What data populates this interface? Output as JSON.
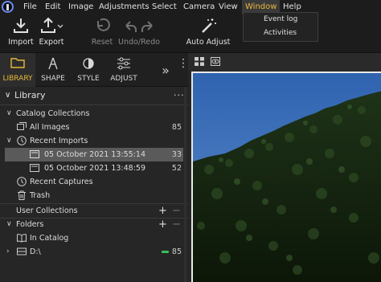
{
  "menubar": {
    "items": [
      "File",
      "Edit",
      "Image",
      "Adjustments",
      "Select",
      "Camera",
      "View",
      "Window",
      "Help"
    ],
    "active": "Window"
  },
  "window_menu": {
    "items": [
      "Event log",
      "Activities"
    ]
  },
  "toolbar": {
    "import_label": "Import",
    "export_label": "Export",
    "reset_label": "Reset",
    "undo_redo_label": "Undo/Redo",
    "auto_adjust_label": "Auto Adjust"
  },
  "tabs": {
    "library": "LIBRARY",
    "shape": "SHAPE",
    "style": "STYLE",
    "adjust": "ADJUST",
    "more": "»",
    "menu": "⋮"
  },
  "library": {
    "title": "Library",
    "menu": "···",
    "catalog_collections": "Catalog Collections",
    "all_images": {
      "label": "All Images",
      "count": "85"
    },
    "recent_imports": "Recent Imports",
    "imports": [
      {
        "label": "05 October 2021 13:55:14",
        "count": "33"
      },
      {
        "label": "05 October 2021 13:48:59",
        "count": "52"
      }
    ],
    "recent_captures": "Recent Captures",
    "trash": "Trash",
    "user_collections": "User Collections",
    "folders": "Folders",
    "in_catalog": "In Catalog",
    "drive": {
      "label": "D:\\",
      "count": "85"
    },
    "plus": "+",
    "minus": "−"
  },
  "colors": {
    "accent": "#e8b83a",
    "selected_row": "#5a5a5a",
    "online_indicator": "#36c05c"
  }
}
